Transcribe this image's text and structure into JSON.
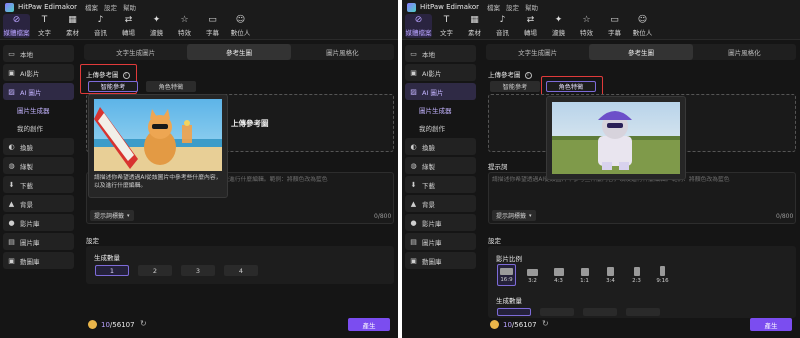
{
  "app": {
    "name": "HitPaw Edimakor",
    "menu": [
      "檔案",
      "設定",
      "幫助"
    ]
  },
  "toolbar": [
    {
      "icon": "media-icon",
      "glyph": "⊘",
      "label": "媒體檔案"
    },
    {
      "icon": "text-icon",
      "glyph": "T",
      "label": "文字"
    },
    {
      "icon": "material-icon",
      "glyph": "▦",
      "label": "素材"
    },
    {
      "icon": "audio-icon",
      "glyph": "♪",
      "label": "音訊"
    },
    {
      "icon": "transition-icon",
      "glyph": "⇄",
      "label": "轉場"
    },
    {
      "icon": "filter-icon",
      "glyph": "✦",
      "label": "濾鏡"
    },
    {
      "icon": "effects-icon",
      "glyph": "☆",
      "label": "特效"
    },
    {
      "icon": "subtitle-icon",
      "glyph": "▭",
      "label": "字幕"
    },
    {
      "icon": "avatar-icon",
      "glyph": "☺",
      "label": "數位人"
    }
  ],
  "sidebar": {
    "items": [
      {
        "icon": "folder-icon",
        "glyph": "▭",
        "label": "本地"
      },
      {
        "icon": "ai-video-icon",
        "glyph": "▣",
        "label": "AI影片"
      },
      {
        "icon": "ai-image-icon",
        "glyph": "▨",
        "label": "AI 圖片"
      },
      {
        "label": "圖片生成器"
      },
      {
        "label": "我的創作"
      },
      {
        "icon": "swap-icon",
        "glyph": "◐",
        "label": "換臉"
      },
      {
        "icon": "sticker-icon",
        "glyph": "◍",
        "label": "綠製"
      },
      {
        "icon": "download-icon",
        "glyph": "⬇",
        "label": "下載"
      },
      {
        "icon": "background-icon",
        "glyph": "▲",
        "label": "背景"
      },
      {
        "icon": "video-library-icon",
        "glyph": "●",
        "label": "影片庫"
      },
      {
        "icon": "image-library-icon",
        "glyph": "▤",
        "label": "圖片庫"
      },
      {
        "icon": "animation-library-icon",
        "glyph": "▣",
        "label": "動圖庫"
      }
    ]
  },
  "tabs": [
    "文字生成圖片",
    "參考生圖",
    "圖片風格化"
  ],
  "upload": {
    "title": "上傳參考圖",
    "smart_ref": "智能參考",
    "character": "角色特徵",
    "box_label": "上傳參考圖"
  },
  "prompt": {
    "title": "提示詞",
    "placeholder_left": "請描述你希望透過AI從該圖片中參考些什麼內容，以及進行什麼編輯。範例：將顏色改為藍色",
    "placeholder_right": "請描述你希望透過AI從該圖片中參考些什麼內容，以及進行什麼編輯。範例：將顏色改為藍色",
    "tag_button": "提示詞標籤",
    "counter": "0/800"
  },
  "popup": {
    "description": "請描述你希望透過AI從該圖片中參考些什麼內容，以及進行什麼編輯。"
  },
  "settings": {
    "title": "設定",
    "count_label": "生成數量",
    "counts": [
      "1",
      "2",
      "3",
      "4"
    ],
    "ratio_label": "影片比例",
    "ratios": [
      "16:9",
      "3:2",
      "4:3",
      "1:1",
      "3:4",
      "2:3",
      "9:16"
    ]
  },
  "bottom": {
    "credits": "10",
    "credits_total": "/56107",
    "generate": "產生"
  }
}
